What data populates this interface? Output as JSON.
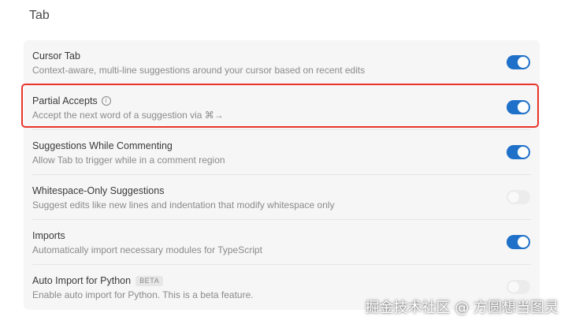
{
  "section": {
    "title": "Tab"
  },
  "settings": [
    {
      "title": "Cursor Tab",
      "description": "Context-aware, multi-line suggestions around your cursor based on recent edits",
      "enabled": true
    },
    {
      "title": "Partial Accepts",
      "description": "Accept the next word of a suggestion via ⌘→",
      "enabled": true,
      "info_icon": "info-icon"
    },
    {
      "title": "Suggestions While Commenting",
      "description": "Allow Tab to trigger while in a comment region",
      "enabled": true
    },
    {
      "title": "Whitespace-Only Suggestions",
      "description": "Suggest edits like new lines and indentation that modify whitespace only",
      "enabled": false
    },
    {
      "title": "Imports",
      "description": "Automatically import necessary modules for TypeScript",
      "enabled": true
    },
    {
      "title": "Auto Import for Python",
      "badge": "BETA",
      "description": "Enable auto import for Python. This is a beta feature.",
      "enabled": false
    }
  ],
  "colors": {
    "toggle_on": "#1f70c8",
    "toggle_off": "#ececec",
    "highlight_border": "#e8342b",
    "panel_bg": "#f6f6f6"
  },
  "watermark": {
    "text": "掘金技术社区 @ 方圆想当图灵"
  }
}
